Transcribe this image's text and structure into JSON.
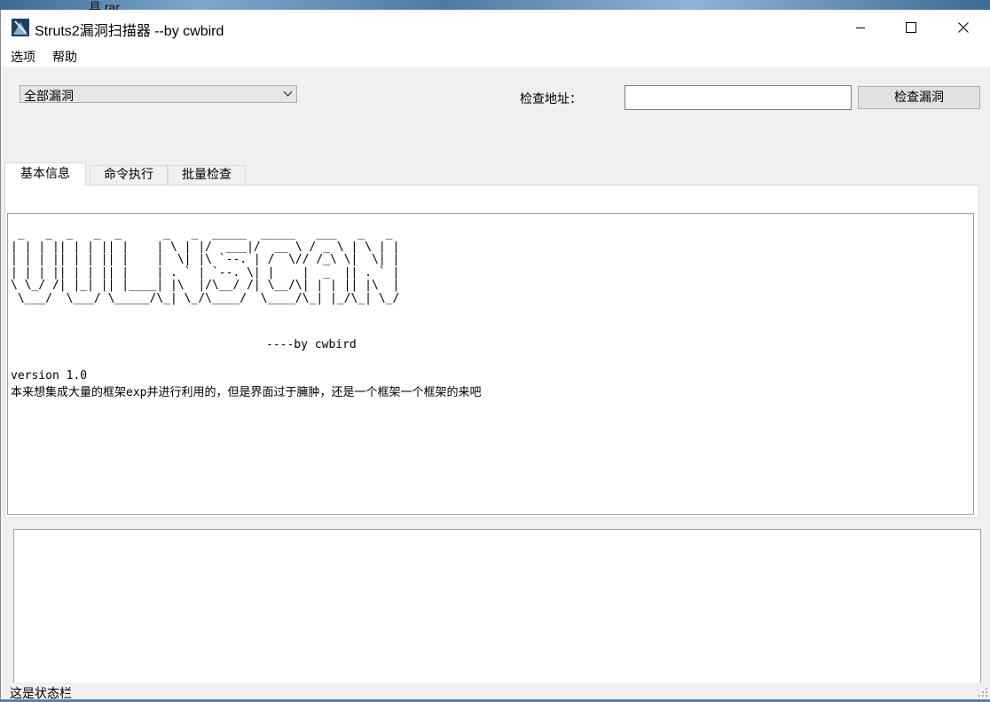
{
  "desktop": {
    "behind_text": "具 rar"
  },
  "window": {
    "title": "Struts2漏洞扫描器 --by cwbird",
    "controls": {
      "minimize": "minimize",
      "maximize": "maximize",
      "close": "close"
    }
  },
  "menu": {
    "items": [
      {
        "label": "选项"
      },
      {
        "label": "帮助"
      }
    ]
  },
  "toolbar": {
    "vuln_select": "全部漏洞",
    "address_label": "检查地址：",
    "address_value": "",
    "check_button": "检查漏洞"
  },
  "tabs": [
    {
      "label": "基本信息",
      "active": true
    },
    {
      "label": "命令执行",
      "active": false
    },
    {
      "label": "批量检查",
      "active": false
    }
  ],
  "info": {
    "banner": " _   _  _   _  _      _   _  _____  _____   ___   _   _ \n| | | || | | || |    | \\ | |/  ___|/  __ \\ / _ \\ | \\ | |\n| | | || | | || |    |  \\| |\\ `--. | /  \\// /_\\ \\|  \\| |\n| | | || | | || |    | . ` | `--. \\| |    |  _  || . ` |\n\\ \\_/ /| |_| || |____| |\\  |/\\__/ /| \\__/\\| | | || |\\  |\n \\___/  \\___/ \\_____/\\_| \\_/\\____/  \\____/\\_| |_/\\_| \\_/",
    "byline": "----by cwbird",
    "version": "version 1.0",
    "description": "本来想集成大量的框架exp并进行利用的，但是界面过于臃肿，还是一个框架一个框架的来吧"
  },
  "output": {
    "text": ""
  },
  "status": {
    "text": "这是状态栏"
  },
  "colors": {
    "window_bg": "#f0f0f0",
    "panel_bg": "#ffffff",
    "border": "#a0a0a0"
  }
}
